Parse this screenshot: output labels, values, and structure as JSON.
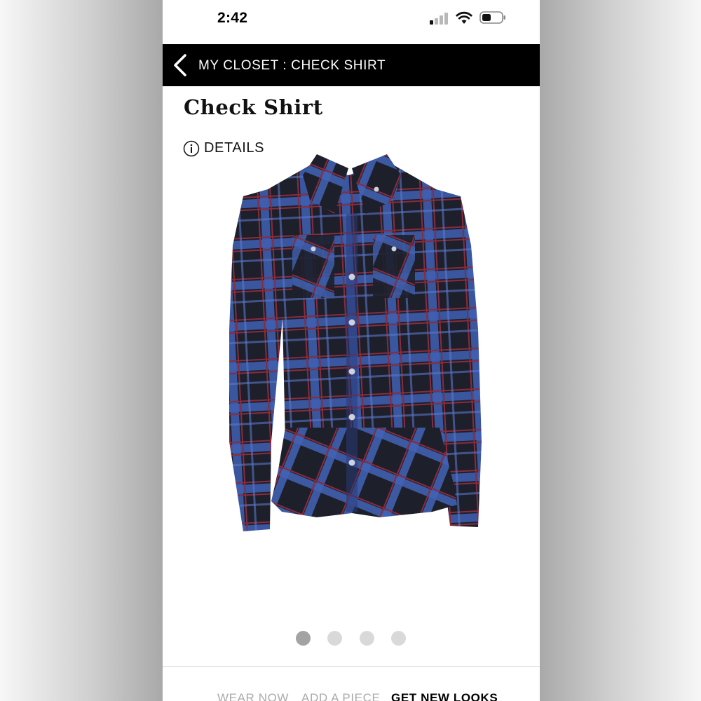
{
  "status_bar": {
    "time": "2:42",
    "signal_icon": "cellular-signal-icon",
    "wifi_icon": "wifi-icon",
    "battery_icon": "battery-icon"
  },
  "nav": {
    "back_icon": "chevron-left-icon",
    "title": "MY CLOSET : CHECK SHIRT"
  },
  "product": {
    "title": "Check Shirt",
    "details_icon": "info-icon",
    "details_label": "DETAILS",
    "image": "plaid-long-sleeve-shirt-image"
  },
  "carousel": {
    "page_count": 4,
    "current_page": 1
  },
  "bottom_tabs": [
    {
      "label": "WEAR NOW",
      "active": false
    },
    {
      "label": "ADD A PIECE",
      "active": false
    },
    {
      "label": "GET NEW LOOKS",
      "active": true
    }
  ],
  "colors": {
    "nav_background": "#000000",
    "active_dot": "#a3a3a3",
    "inactive_dot": "#d9d9d9"
  }
}
